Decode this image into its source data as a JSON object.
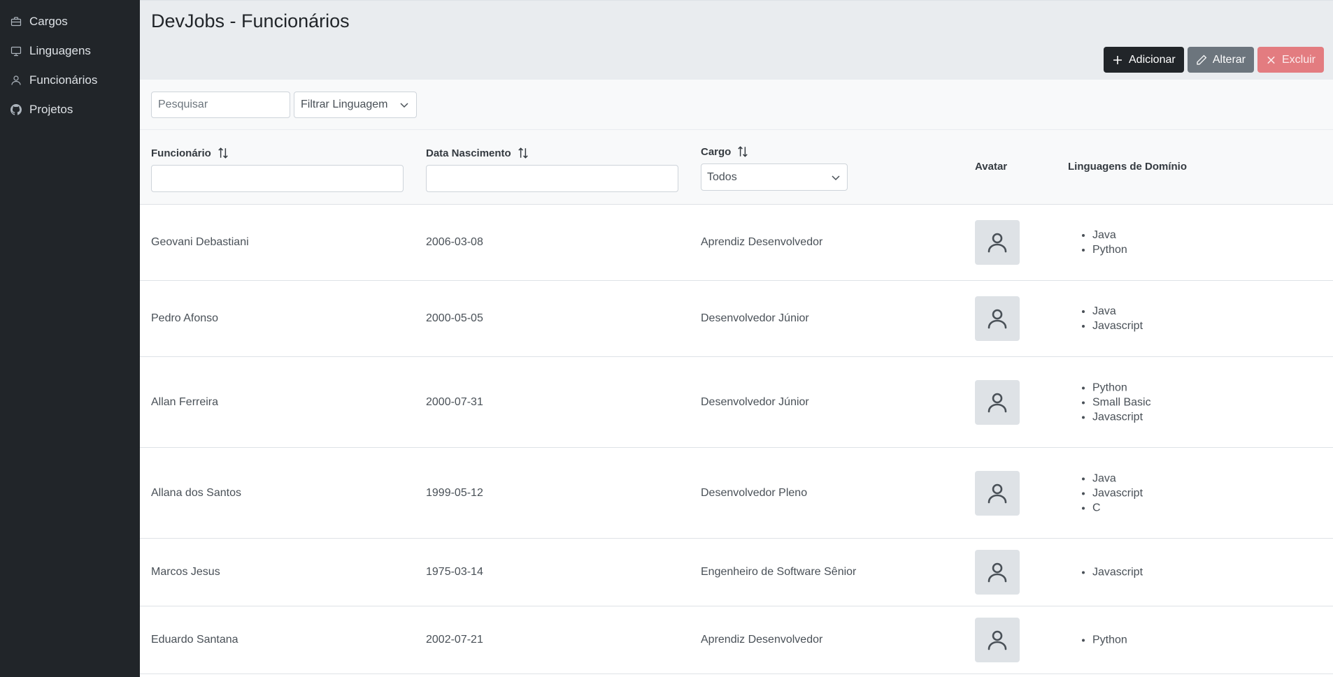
{
  "sidebar": {
    "items": [
      {
        "label": "Cargos",
        "icon": "briefcase-icon"
      },
      {
        "label": "Linguagens",
        "icon": "monitor-icon"
      },
      {
        "label": "Funcionários",
        "icon": "user-icon"
      },
      {
        "label": "Projetos",
        "icon": "github-icon"
      }
    ]
  },
  "header": {
    "title": "DevJobs - Funcionários",
    "add_label": "Adicionar",
    "edit_label": "Alterar",
    "delete_label": "Excluir"
  },
  "toolbar": {
    "search_placeholder": "Pesquisar",
    "language_filter_label": "Filtrar Linguagem"
  },
  "table": {
    "columns": {
      "name": "Funcionário",
      "birth": "Data Nascimento",
      "role": "Cargo",
      "avatar": "Avatar",
      "languages": "Linguagens de Domínio"
    },
    "role_filter_value": "Todos",
    "rows": [
      {
        "name": "Geovani Debastiani",
        "birth": "2006-03-08",
        "role": "Aprendiz Desenvolvedor",
        "languages": [
          "Java",
          "Python"
        ]
      },
      {
        "name": "Pedro Afonso",
        "birth": "2000-05-05",
        "role": "Desenvolvedor Júnior",
        "languages": [
          "Java",
          "Javascript"
        ]
      },
      {
        "name": "Allan Ferreira",
        "birth": "2000-07-31",
        "role": "Desenvolvedor Júnior",
        "languages": [
          "Python",
          "Small Basic",
          "Javascript"
        ]
      },
      {
        "name": "Allana dos Santos",
        "birth": "1999-05-12",
        "role": "Desenvolvedor Pleno",
        "languages": [
          "Java",
          "Javascript",
          "C"
        ]
      },
      {
        "name": "Marcos Jesus",
        "birth": "1975-03-14",
        "role": "Engenheiro de Software Sênior",
        "languages": [
          "Javascript"
        ]
      },
      {
        "name": "Eduardo Santana",
        "birth": "2002-07-21",
        "role": "Aprendiz Desenvolvedor",
        "languages": [
          "Python"
        ]
      }
    ]
  },
  "colors": {
    "sidebar_bg": "#212529",
    "header_bg": "#e9ecef",
    "add_button": "#212529",
    "edit_button": "#6c757d",
    "delete_button": "#e37c80"
  }
}
